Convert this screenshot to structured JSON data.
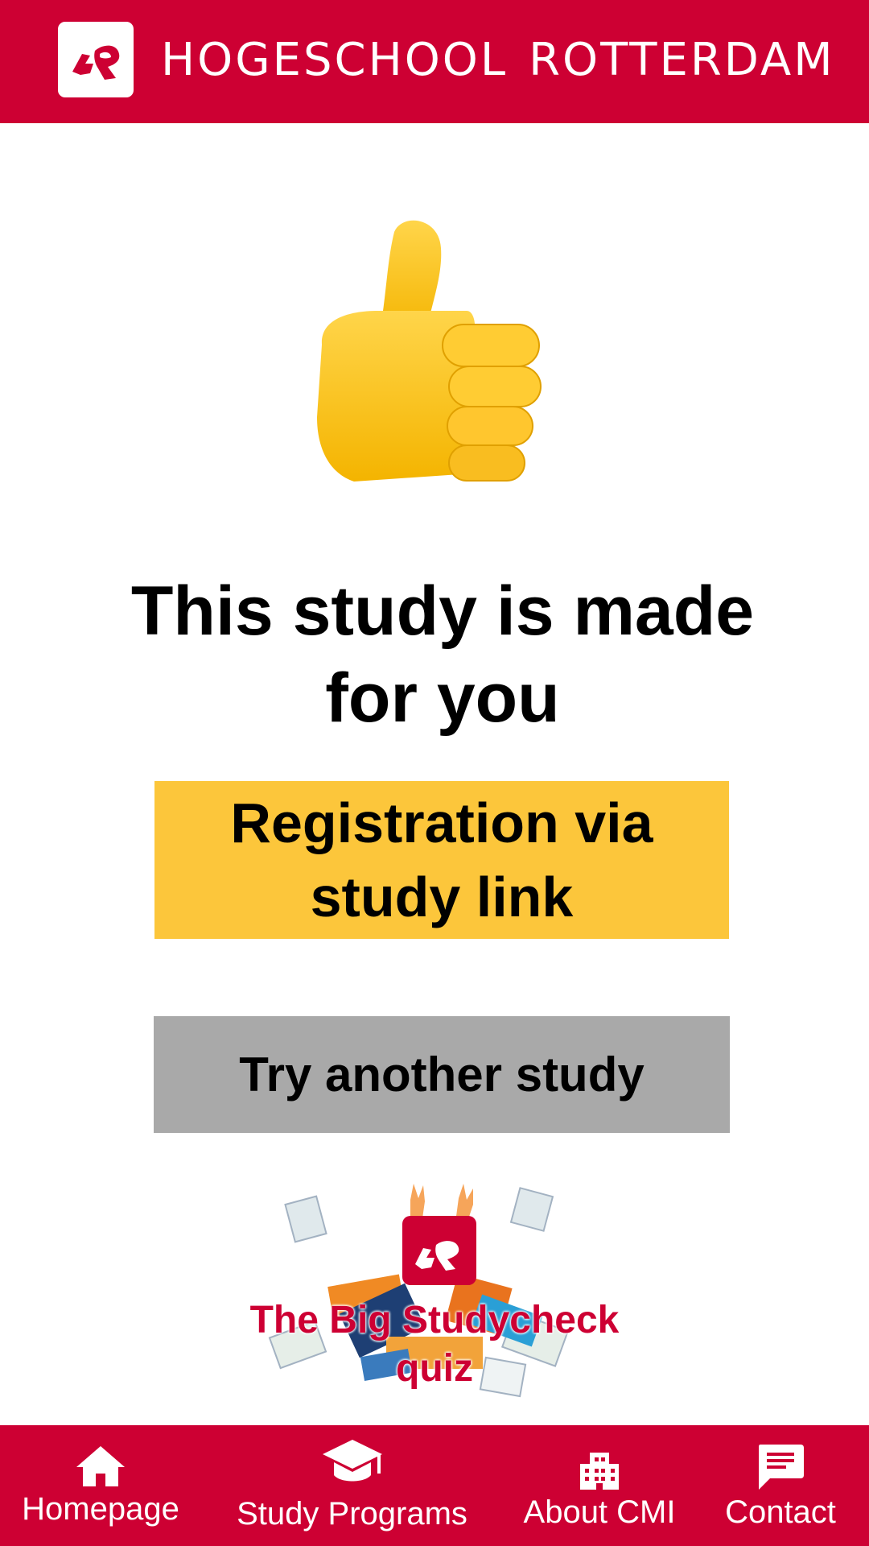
{
  "header": {
    "brand_word1": "HOGESCHOOL",
    "brand_word2": "ROTTERDAM",
    "logo_icon": "hr-logo-icon",
    "color": "#cd0033"
  },
  "result": {
    "icon": "thumbs-up-icon",
    "headline": "This study is made for you"
  },
  "actions": {
    "register_label": "Registration via study link",
    "register_color": "#fcc63b",
    "retry_label": "Try another study",
    "retry_color": "#a9a9a9"
  },
  "quiz_logo": {
    "title": "The Big Studycheck quiz"
  },
  "tabbar": {
    "items": [
      {
        "label": "Homepage",
        "icon": "home-icon"
      },
      {
        "label": "Study Programs",
        "icon": "graduation-cap-icon"
      },
      {
        "label": "About CMI",
        "icon": "building-icon"
      },
      {
        "label": "Contact",
        "icon": "chat-icon"
      }
    ]
  }
}
